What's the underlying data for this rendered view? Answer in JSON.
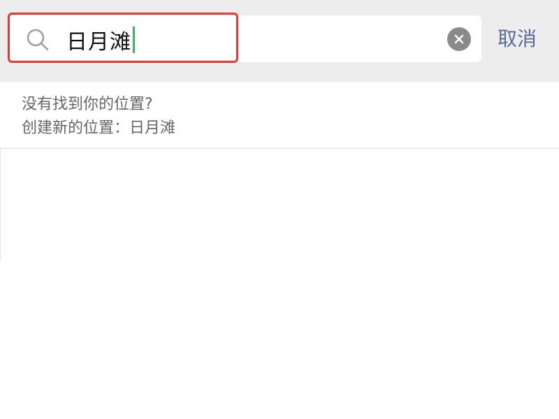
{
  "search": {
    "value": "日月滩",
    "clear_icon": "clear-icon",
    "search_icon": "search-icon"
  },
  "actions": {
    "cancel_label": "取消"
  },
  "results": {
    "prompt": "没有找到你的位置?",
    "create_label": "创建新的位置：日月滩"
  },
  "colors": {
    "highlight": "#e53935",
    "cancel": "#576b95",
    "caret": "#3fb35b"
  }
}
